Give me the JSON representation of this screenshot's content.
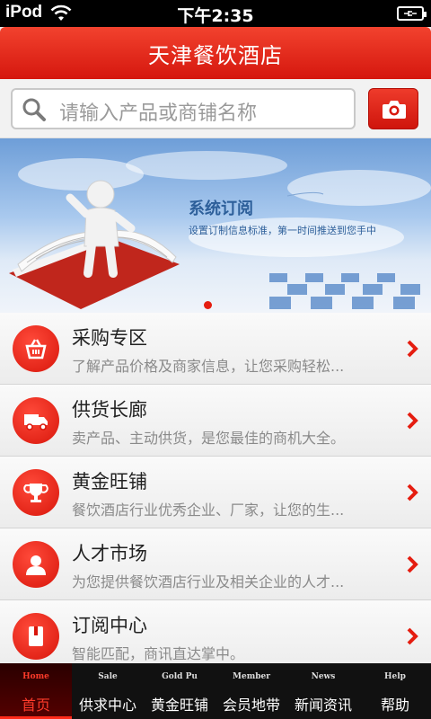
{
  "status_bar": {
    "carrier": "iPod",
    "time": "下午2:35"
  },
  "header": {
    "title": "天津餐饮酒店"
  },
  "search": {
    "placeholder": "请输入产品或商铺名称"
  },
  "banner": {
    "title": "系统订阅",
    "subtitle": "设置订制信息标准，第一时间推送到您手中"
  },
  "menu": [
    {
      "title": "采购专区",
      "desc": "了解产品价格及商家信息，让您采购轻松...",
      "icon": "basket-icon"
    },
    {
      "title": "供货长廊",
      "desc": "卖产品、主动供货，是您最佳的商机大全。",
      "icon": "truck-icon"
    },
    {
      "title": "黄金旺铺",
      "desc": "餐饮酒店行业优秀企业、厂家，让您的生...",
      "icon": "trophy-icon"
    },
    {
      "title": "人才市场",
      "desc": "为您提供餐饮酒店行业及相关企业的人才...",
      "icon": "person-icon"
    },
    {
      "title": "订阅中心",
      "desc": "智能匹配，商讯直达掌中。",
      "icon": "book-icon"
    }
  ],
  "bottom_nav": [
    {
      "en": "Home",
      "zh": "首页",
      "active": true
    },
    {
      "en": "Sale",
      "zh": "供求中心",
      "active": false
    },
    {
      "en": "Gold Pu",
      "zh": "黄金旺铺",
      "active": false
    },
    {
      "en": "Member",
      "zh": "会员地带",
      "active": false
    },
    {
      "en": "News",
      "zh": "新闻资讯",
      "active": false
    },
    {
      "en": "Help",
      "zh": "帮助",
      "active": false
    }
  ],
  "colors": {
    "brand_red": "#e51d10",
    "nav_bg": "#111111"
  }
}
